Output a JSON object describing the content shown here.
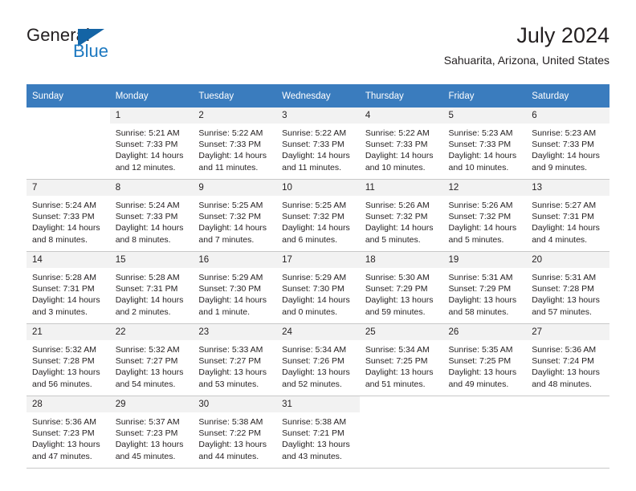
{
  "logo": {
    "word_one": "General",
    "word_two": "Blue",
    "triangle_color": "#1464a5",
    "blue_color": "#1c78c0"
  },
  "header": {
    "title": "July 2024",
    "subtitle": "Sahuarita, Arizona, United States",
    "header_bg": "#3a7cbe",
    "daynum_bg": "#f2f2f2"
  },
  "weekdays": [
    "Sunday",
    "Monday",
    "Tuesday",
    "Wednesday",
    "Thursday",
    "Friday",
    "Saturday"
  ],
  "weeks": [
    [
      {
        "day": "",
        "blank": true,
        "sunrise": "",
        "sunset": "",
        "daylight1": "",
        "daylight2": ""
      },
      {
        "day": "1",
        "sunrise": "Sunrise: 5:21 AM",
        "sunset": "Sunset: 7:33 PM",
        "daylight1": "Daylight: 14 hours",
        "daylight2": "and 12 minutes."
      },
      {
        "day": "2",
        "sunrise": "Sunrise: 5:22 AM",
        "sunset": "Sunset: 7:33 PM",
        "daylight1": "Daylight: 14 hours",
        "daylight2": "and 11 minutes."
      },
      {
        "day": "3",
        "sunrise": "Sunrise: 5:22 AM",
        "sunset": "Sunset: 7:33 PM",
        "daylight1": "Daylight: 14 hours",
        "daylight2": "and 11 minutes."
      },
      {
        "day": "4",
        "sunrise": "Sunrise: 5:22 AM",
        "sunset": "Sunset: 7:33 PM",
        "daylight1": "Daylight: 14 hours",
        "daylight2": "and 10 minutes."
      },
      {
        "day": "5",
        "sunrise": "Sunrise: 5:23 AM",
        "sunset": "Sunset: 7:33 PM",
        "daylight1": "Daylight: 14 hours",
        "daylight2": "and 10 minutes."
      },
      {
        "day": "6",
        "sunrise": "Sunrise: 5:23 AM",
        "sunset": "Sunset: 7:33 PM",
        "daylight1": "Daylight: 14 hours",
        "daylight2": "and 9 minutes."
      }
    ],
    [
      {
        "day": "7",
        "sunrise": "Sunrise: 5:24 AM",
        "sunset": "Sunset: 7:33 PM",
        "daylight1": "Daylight: 14 hours",
        "daylight2": "and 8 minutes."
      },
      {
        "day": "8",
        "sunrise": "Sunrise: 5:24 AM",
        "sunset": "Sunset: 7:33 PM",
        "daylight1": "Daylight: 14 hours",
        "daylight2": "and 8 minutes."
      },
      {
        "day": "9",
        "sunrise": "Sunrise: 5:25 AM",
        "sunset": "Sunset: 7:32 PM",
        "daylight1": "Daylight: 14 hours",
        "daylight2": "and 7 minutes."
      },
      {
        "day": "10",
        "sunrise": "Sunrise: 5:25 AM",
        "sunset": "Sunset: 7:32 PM",
        "daylight1": "Daylight: 14 hours",
        "daylight2": "and 6 minutes."
      },
      {
        "day": "11",
        "sunrise": "Sunrise: 5:26 AM",
        "sunset": "Sunset: 7:32 PM",
        "daylight1": "Daylight: 14 hours",
        "daylight2": "and 5 minutes."
      },
      {
        "day": "12",
        "sunrise": "Sunrise: 5:26 AM",
        "sunset": "Sunset: 7:32 PM",
        "daylight1": "Daylight: 14 hours",
        "daylight2": "and 5 minutes."
      },
      {
        "day": "13",
        "sunrise": "Sunrise: 5:27 AM",
        "sunset": "Sunset: 7:31 PM",
        "daylight1": "Daylight: 14 hours",
        "daylight2": "and 4 minutes."
      }
    ],
    [
      {
        "day": "14",
        "sunrise": "Sunrise: 5:28 AM",
        "sunset": "Sunset: 7:31 PM",
        "daylight1": "Daylight: 14 hours",
        "daylight2": "and 3 minutes."
      },
      {
        "day": "15",
        "sunrise": "Sunrise: 5:28 AM",
        "sunset": "Sunset: 7:31 PM",
        "daylight1": "Daylight: 14 hours",
        "daylight2": "and 2 minutes."
      },
      {
        "day": "16",
        "sunrise": "Sunrise: 5:29 AM",
        "sunset": "Sunset: 7:30 PM",
        "daylight1": "Daylight: 14 hours",
        "daylight2": "and 1 minute."
      },
      {
        "day": "17",
        "sunrise": "Sunrise: 5:29 AM",
        "sunset": "Sunset: 7:30 PM",
        "daylight1": "Daylight: 14 hours",
        "daylight2": "and 0 minutes."
      },
      {
        "day": "18",
        "sunrise": "Sunrise: 5:30 AM",
        "sunset": "Sunset: 7:29 PM",
        "daylight1": "Daylight: 13 hours",
        "daylight2": "and 59 minutes."
      },
      {
        "day": "19",
        "sunrise": "Sunrise: 5:31 AM",
        "sunset": "Sunset: 7:29 PM",
        "daylight1": "Daylight: 13 hours",
        "daylight2": "and 58 minutes."
      },
      {
        "day": "20",
        "sunrise": "Sunrise: 5:31 AM",
        "sunset": "Sunset: 7:28 PM",
        "daylight1": "Daylight: 13 hours",
        "daylight2": "and 57 minutes."
      }
    ],
    [
      {
        "day": "21",
        "sunrise": "Sunrise: 5:32 AM",
        "sunset": "Sunset: 7:28 PM",
        "daylight1": "Daylight: 13 hours",
        "daylight2": "and 56 minutes."
      },
      {
        "day": "22",
        "sunrise": "Sunrise: 5:32 AM",
        "sunset": "Sunset: 7:27 PM",
        "daylight1": "Daylight: 13 hours",
        "daylight2": "and 54 minutes."
      },
      {
        "day": "23",
        "sunrise": "Sunrise: 5:33 AM",
        "sunset": "Sunset: 7:27 PM",
        "daylight1": "Daylight: 13 hours",
        "daylight2": "and 53 minutes."
      },
      {
        "day": "24",
        "sunrise": "Sunrise: 5:34 AM",
        "sunset": "Sunset: 7:26 PM",
        "daylight1": "Daylight: 13 hours",
        "daylight2": "and 52 minutes."
      },
      {
        "day": "25",
        "sunrise": "Sunrise: 5:34 AM",
        "sunset": "Sunset: 7:25 PM",
        "daylight1": "Daylight: 13 hours",
        "daylight2": "and 51 minutes."
      },
      {
        "day": "26",
        "sunrise": "Sunrise: 5:35 AM",
        "sunset": "Sunset: 7:25 PM",
        "daylight1": "Daylight: 13 hours",
        "daylight2": "and 49 minutes."
      },
      {
        "day": "27",
        "sunrise": "Sunrise: 5:36 AM",
        "sunset": "Sunset: 7:24 PM",
        "daylight1": "Daylight: 13 hours",
        "daylight2": "and 48 minutes."
      }
    ],
    [
      {
        "day": "28",
        "sunrise": "Sunrise: 5:36 AM",
        "sunset": "Sunset: 7:23 PM",
        "daylight1": "Daylight: 13 hours",
        "daylight2": "and 47 minutes."
      },
      {
        "day": "29",
        "sunrise": "Sunrise: 5:37 AM",
        "sunset": "Sunset: 7:23 PM",
        "daylight1": "Daylight: 13 hours",
        "daylight2": "and 45 minutes."
      },
      {
        "day": "30",
        "sunrise": "Sunrise: 5:38 AM",
        "sunset": "Sunset: 7:22 PM",
        "daylight1": "Daylight: 13 hours",
        "daylight2": "and 44 minutes."
      },
      {
        "day": "31",
        "sunrise": "Sunrise: 5:38 AM",
        "sunset": "Sunset: 7:21 PM",
        "daylight1": "Daylight: 13 hours",
        "daylight2": "and 43 minutes."
      },
      {
        "day": "",
        "blank": true,
        "sunrise": "",
        "sunset": "",
        "daylight1": "",
        "daylight2": ""
      },
      {
        "day": "",
        "blank": true,
        "sunrise": "",
        "sunset": "",
        "daylight1": "",
        "daylight2": ""
      },
      {
        "day": "",
        "blank": true,
        "sunrise": "",
        "sunset": "",
        "daylight1": "",
        "daylight2": ""
      }
    ]
  ]
}
